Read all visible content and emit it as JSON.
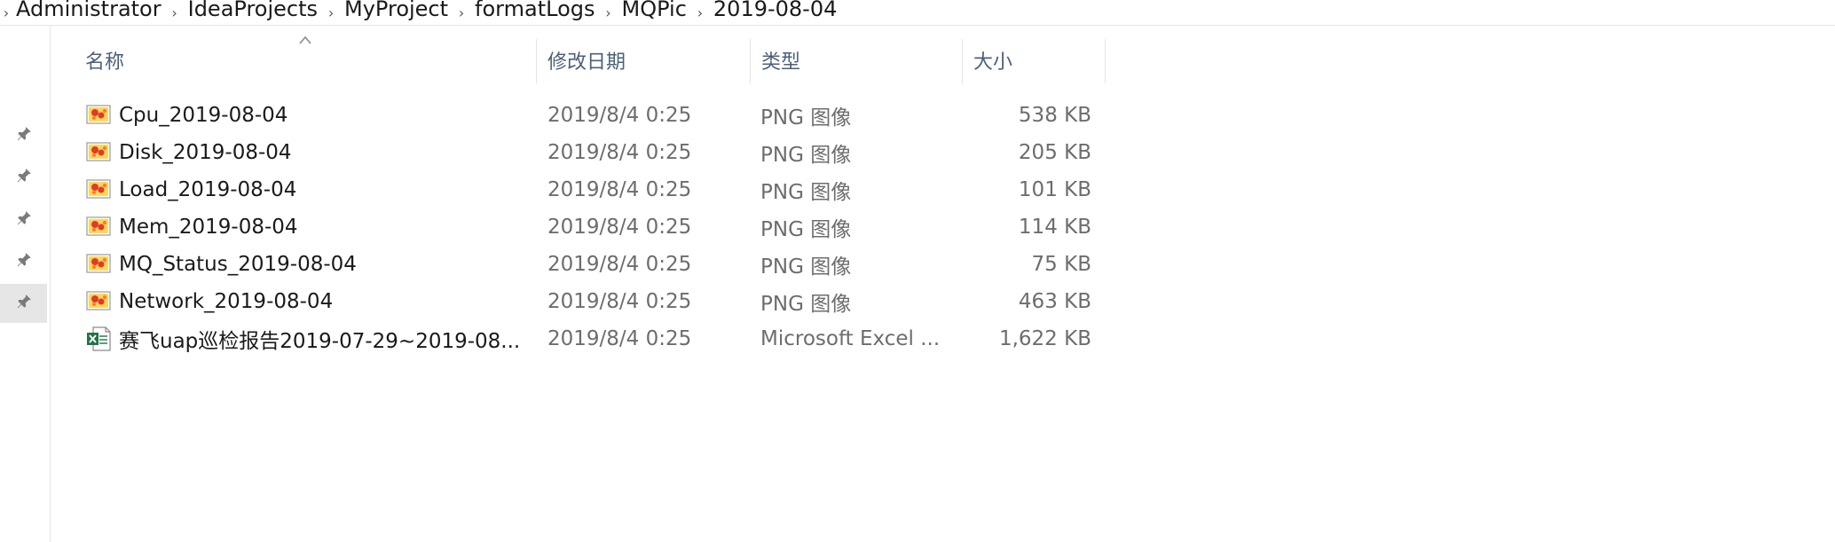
{
  "breadcrumb": {
    "items": [
      {
        "label": "Administrator"
      },
      {
        "label": "IdeaProjects"
      },
      {
        "label": "MyProject"
      },
      {
        "label": "formatLogs"
      },
      {
        "label": "MQPic"
      },
      {
        "label": "2019-08-04"
      }
    ]
  },
  "columns": {
    "name": "名称",
    "date": "修改日期",
    "type": "类型",
    "size": "大小"
  },
  "files": [
    {
      "name": "Cpu_2019-08-04",
      "date": "2019/8/4 0:25",
      "type": "PNG 图像",
      "size": "538 KB",
      "icon": "png-image-icon"
    },
    {
      "name": "Disk_2019-08-04",
      "date": "2019/8/4 0:25",
      "type": "PNG 图像",
      "size": "205 KB",
      "icon": "png-image-icon"
    },
    {
      "name": "Load_2019-08-04",
      "date": "2019/8/4 0:25",
      "type": "PNG 图像",
      "size": "101 KB",
      "icon": "png-image-icon"
    },
    {
      "name": "Mem_2019-08-04",
      "date": "2019/8/4 0:25",
      "type": "PNG 图像",
      "size": "114 KB",
      "icon": "png-image-icon"
    },
    {
      "name": "MQ_Status_2019-08-04",
      "date": "2019/8/4 0:25",
      "type": "PNG 图像",
      "size": "75 KB",
      "icon": "png-image-icon"
    },
    {
      "name": "Network_2019-08-04",
      "date": "2019/8/4 0:25",
      "type": "PNG 图像",
      "size": "463 KB",
      "icon": "png-image-icon"
    },
    {
      "name": "赛飞uap巡检报告2019-07-29~2019-08...",
      "date": "2019/8/4 0:25",
      "type": "Microsoft Excel ...",
      "size": "1,622 KB",
      "icon": "excel-file-icon"
    }
  ],
  "icons": {
    "pin": "pin-icon",
    "sort": "sort-ascending-icon"
  },
  "colors": {
    "header_text": "#4c607a",
    "secondary_text": "#6d6d6d",
    "excel_green": "#217346",
    "image_icon_red": "#e03a2a"
  }
}
